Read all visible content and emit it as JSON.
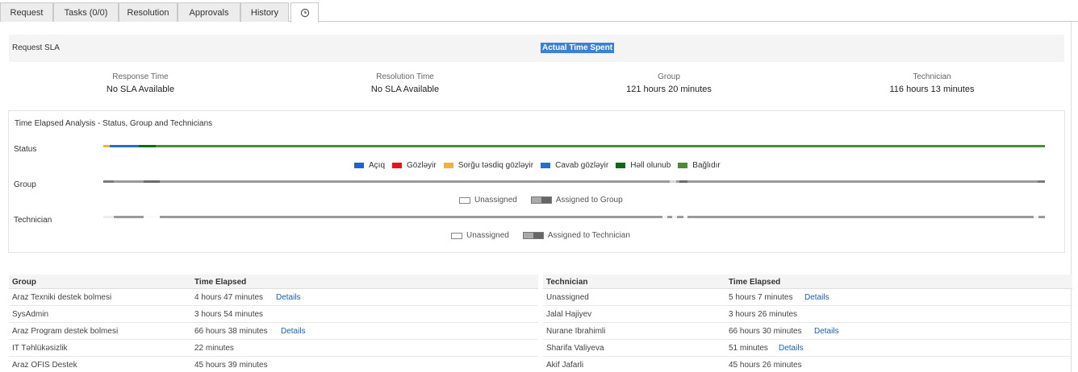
{
  "tabs": [
    {
      "label": "Request"
    },
    {
      "label": "Tasks (0/0)"
    },
    {
      "label": "Resolution"
    },
    {
      "label": "Approvals"
    },
    {
      "label": "History"
    },
    {
      "label": "",
      "icon": "clock-icon"
    }
  ],
  "sla": {
    "title": "Request SLA",
    "highlight": "Actual Time Spent",
    "columns": [
      {
        "label": "Response Time",
        "value": "No SLA Available"
      },
      {
        "label": "Resolution Time",
        "value": "No SLA Available"
      },
      {
        "label": "Group",
        "value": "121 hours 20 minutes"
      },
      {
        "label": "Technician",
        "value": "116 hours 13 minutes"
      }
    ]
  },
  "analysis": {
    "title": "Time Elapsed Analysis - Status, Group and Technicians",
    "status_label": "Status",
    "group_label": "Group",
    "technician_label": "Technician",
    "status_legend": [
      {
        "label": "Açıq",
        "color": "#1e63d6"
      },
      {
        "label": "Gözləyir",
        "color": "#e8141c"
      },
      {
        "label": "Sorğu təsdiq gözləyir",
        "color": "#f0b23c"
      },
      {
        "label": "Cavab gözləyir",
        "color": "#2a6cc9"
      },
      {
        "label": "Həll olunub",
        "color": "#0a6b14"
      },
      {
        "label": "Bağlıdır",
        "color": "#4f8b36"
      }
    ],
    "group_legend": {
      "unassigned": "Unassigned",
      "assigned": "Assigned to Group"
    },
    "technician_legend": {
      "unassigned": "Unassigned",
      "assigned": "Assigned to Technician"
    }
  },
  "group_table": {
    "headers": [
      "Group",
      "Time Elapsed"
    ],
    "rows": [
      {
        "name": "Araz Texniki destek bolmesi",
        "time": "4 hours 47 minutes",
        "details": "Details"
      },
      {
        "name": "SysAdmin",
        "time": "3 hours 54 minutes",
        "details": ""
      },
      {
        "name": "Araz Program destek bolmesi",
        "time": "66 hours 38 minutes",
        "details": "Details"
      },
      {
        "name": "IT Təhlükəsizlik",
        "time": "22 minutes",
        "details": ""
      },
      {
        "name": "Araz OFIS Destek",
        "time": "45 hours 39 minutes",
        "details": ""
      }
    ]
  },
  "technician_table": {
    "headers": [
      "Technician",
      "Time Elapsed"
    ],
    "rows": [
      {
        "name": "Unassigned",
        "time": "5 hours 7 minutes",
        "details": "Details"
      },
      {
        "name": "Jalal Hajiyev",
        "time": "3 hours 26 minutes",
        "details": ""
      },
      {
        "name": "Nurane Ibrahimli",
        "time": "66 hours 30 minutes",
        "details": "Details"
      },
      {
        "name": "Sharifa Valiyeva",
        "time": "51 minutes",
        "details": "Details"
      },
      {
        "name": "Akif Jafarli",
        "time": "45 hours 26 minutes",
        "details": ""
      }
    ]
  }
}
